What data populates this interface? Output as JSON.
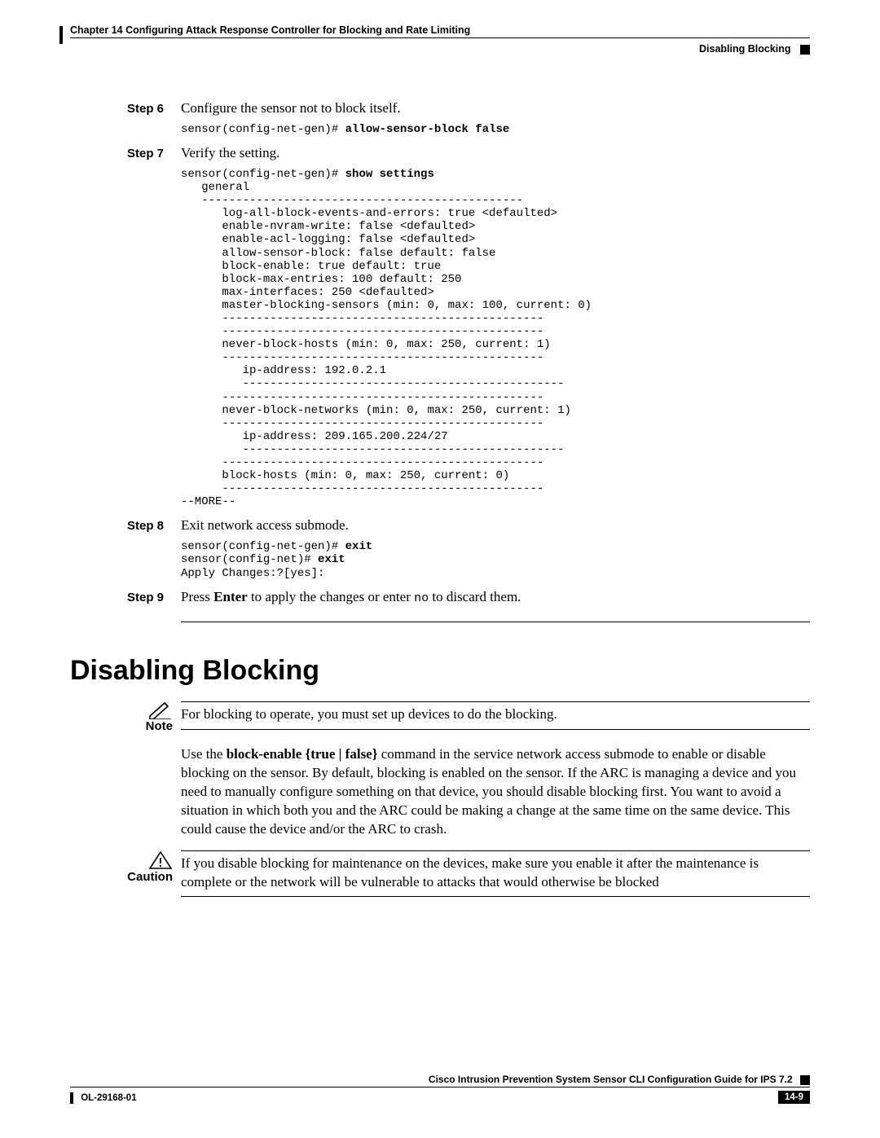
{
  "header": {
    "chapter_line": "Chapter 14      Configuring Attack Response Controller for Blocking and Rate Limiting",
    "section_right": "Disabling Blocking"
  },
  "steps": {
    "step6": {
      "label": "Step 6",
      "text": "Configure the sensor not to block itself."
    },
    "step6_code_prompt": "sensor(config-net-gen)# ",
    "step6_code_cmd": "allow-sensor-block false",
    "step7": {
      "label": "Step 7",
      "text": "Verify the setting."
    },
    "step7_code_prompt": "sensor(config-net-gen)# ",
    "step7_code_cmd": "show settings",
    "step7_code_body": "   general\n   -----------------------------------------------\n      log-all-block-events-and-errors: true <defaulted>\n      enable-nvram-write: false <defaulted>\n      enable-acl-logging: false <defaulted>\n      allow-sensor-block: false default: false\n      block-enable: true default: true\n      block-max-entries: 100 default: 250\n      max-interfaces: 250 <defaulted>\n      master-blocking-sensors (min: 0, max: 100, current: 0)\n      -----------------------------------------------\n      -----------------------------------------------\n      never-block-hosts (min: 0, max: 250, current: 1)\n      -----------------------------------------------\n         ip-address: 192.0.2.1\n         -----------------------------------------------\n      -----------------------------------------------\n      never-block-networks (min: 0, max: 250, current: 1)\n      -----------------------------------------------\n         ip-address: 209.165.200.224/27\n         -----------------------------------------------\n      -----------------------------------------------\n      block-hosts (min: 0, max: 250, current: 0)\n      -----------------------------------------------\n--MORE--",
    "step8": {
      "label": "Step 8",
      "text": "Exit network access submode."
    },
    "step8_code_l1_prompt": "sensor(config-net-gen)# ",
    "step8_code_l1_cmd": "exit",
    "step8_code_l2_prompt": "sensor(config-net)# ",
    "step8_code_l2_cmd": "exit",
    "step8_code_l3": "Apply Changes:?[yes]:",
    "step9": {
      "label": "Step 9",
      "t1": "Press ",
      "t2": "Enter",
      "t3": " to apply the changes or enter ",
      "t4": "no",
      "t5": " to discard them."
    }
  },
  "section": {
    "title": "Disabling Blocking",
    "note_label": "Note",
    "note_text": "For blocking to operate, you must set up devices to do the blocking.",
    "para_pre": "Use the ",
    "para_cmd": "block-enable {true | false}",
    "para_post": " command in the service network access submode to enable or disable blocking on the sensor. By default, blocking is enabled on the sensor. If the ARC is managing a device and you need to manually configure something on that device, you should disable blocking first. You want to avoid a situation in which both you and the ARC could be making a change at the same time on the same device. This could cause the device and/or the ARC to crash.",
    "caution_label": "Caution",
    "caution_text": "If you disable blocking for maintenance on the devices, make sure you enable it after the maintenance is complete or the network will be vulnerable to attacks that would otherwise be blocked"
  },
  "footer": {
    "guide": "Cisco Intrusion Prevention System Sensor CLI Configuration Guide for IPS 7.2",
    "doc_id": "OL-29168-01",
    "page_num": "14-9"
  }
}
